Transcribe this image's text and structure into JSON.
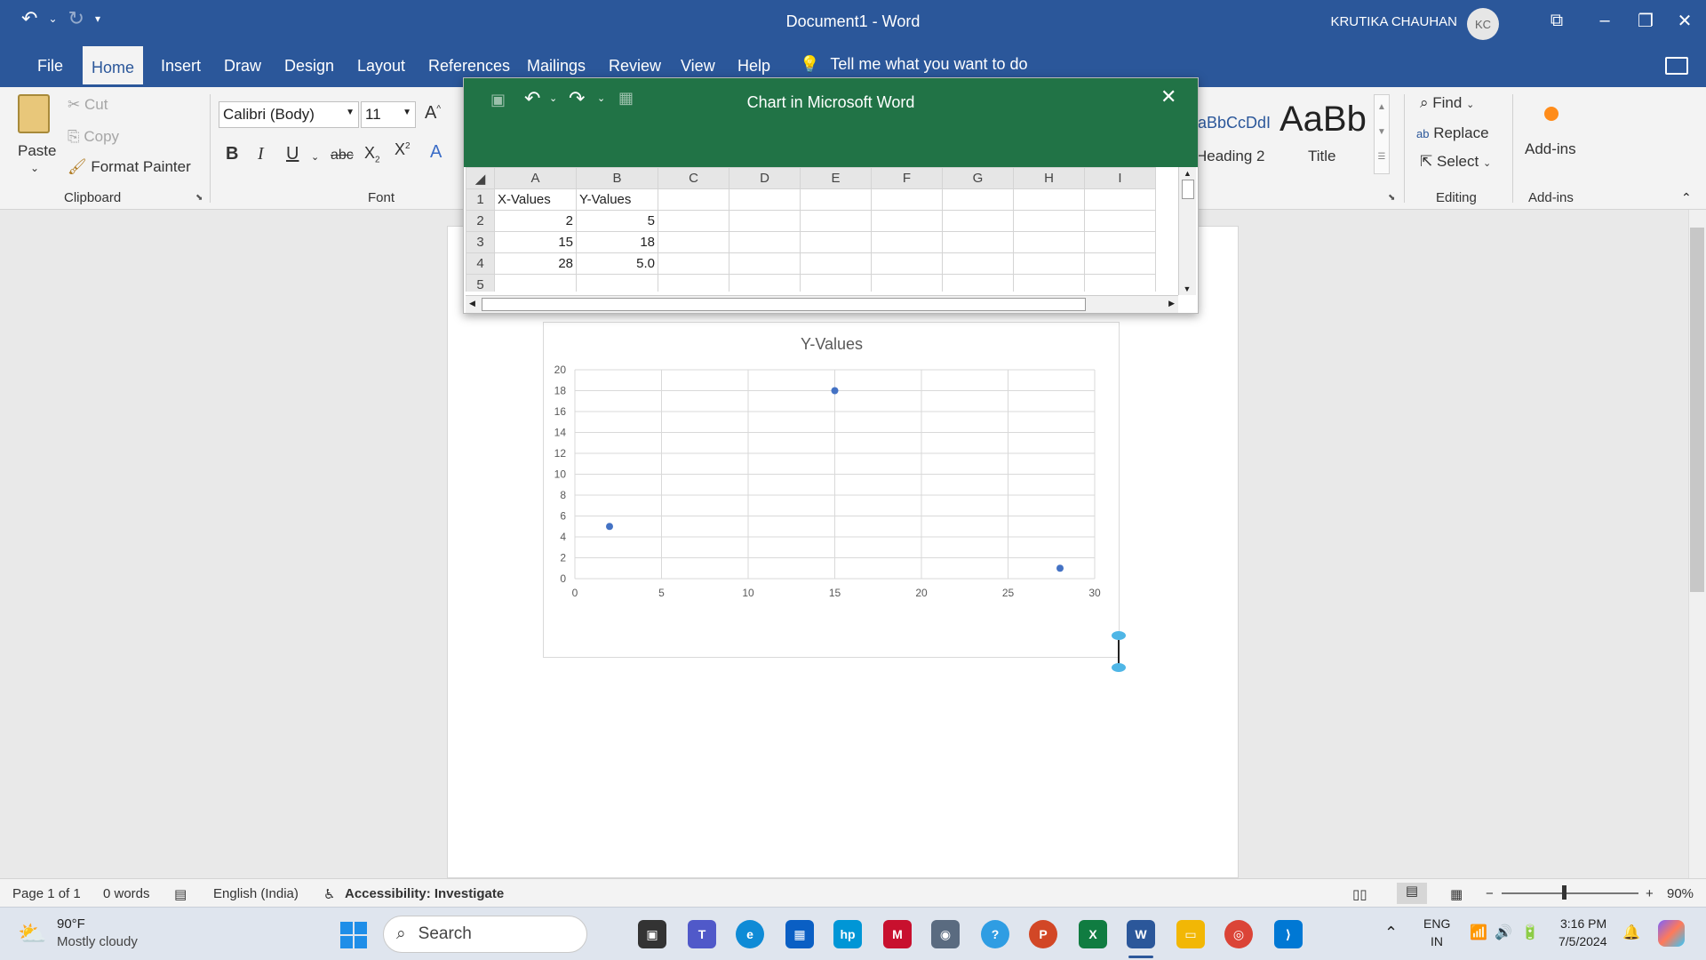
{
  "titlebar": {
    "doc_title": "Document1  -  Word",
    "user_name": "KRUTIKA CHAUHAN",
    "user_initials": "KC"
  },
  "tabs": [
    "File",
    "Home",
    "Insert",
    "Draw",
    "Design",
    "Layout",
    "References",
    "Mailings",
    "Review",
    "View",
    "Help"
  ],
  "active_tab": "Home",
  "tell_me": "Tell me what you want to do",
  "ribbon": {
    "paste": "Paste",
    "cut": "Cut",
    "copy": "Copy",
    "format_painter": "Format Painter",
    "clipboard_label": "Clipboard",
    "font_name": "Calibri (Body)",
    "font_size": "11",
    "font_label": "Font",
    "style_heading2_sample": "aBbCcDdI",
    "style_heading2": "Heading 2",
    "style_title_sample": "AaBb",
    "style_title": "Title",
    "find": "Find",
    "replace": "Replace",
    "select": "Select",
    "editing_label": "Editing",
    "addins": "Add-ins",
    "addins_label": "Add-ins"
  },
  "sheet": {
    "title": "Chart in Microsoft Word",
    "columns": [
      "A",
      "B",
      "C",
      "D",
      "E",
      "F",
      "G",
      "H",
      "I"
    ],
    "rows": [
      [
        "1",
        "X-Values",
        "Y-Values"
      ],
      [
        "2",
        "2",
        "5"
      ],
      [
        "3",
        "15",
        "18"
      ],
      [
        "4",
        "28",
        "5.0"
      ],
      [
        "5",
        "",
        ""
      ]
    ]
  },
  "chart_data": {
    "type": "scatter",
    "title": "Y-Values",
    "x": [
      2,
      15,
      28
    ],
    "y": [
      5,
      18,
      1
    ],
    "xlim": [
      0,
      30
    ],
    "ylim": [
      0,
      20
    ],
    "xticks": [
      "0",
      "5",
      "10",
      "15",
      "20",
      "25",
      "30"
    ],
    "yticks": [
      "0",
      "2",
      "4",
      "6",
      "8",
      "10",
      "12",
      "14",
      "16",
      "18",
      "20"
    ],
    "grid": true,
    "marker_color": "#4472c4"
  },
  "statusbar": {
    "page": "Page 1 of 1",
    "words": "0 words",
    "language": "English (India)",
    "accessibility": "Accessibility: Investigate",
    "zoom": "90%"
  },
  "taskbar": {
    "weather_temp": "90°F",
    "weather_desc": "Mostly cloudy",
    "search": "Search",
    "lang1": "ENG",
    "lang2": "IN",
    "time": "3:16 PM",
    "date": "7/5/2024"
  },
  "colors": {
    "word_blue": "#2b579a",
    "excel_green": "#217346"
  }
}
